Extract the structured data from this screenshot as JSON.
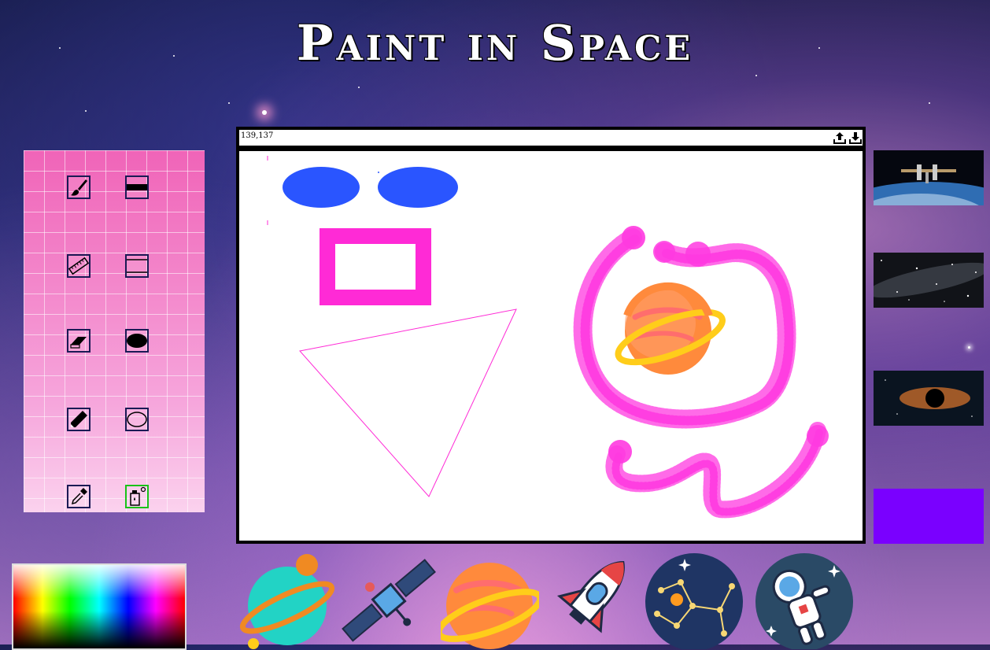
{
  "app": {
    "title": "Paint in Space"
  },
  "canvas": {
    "coordinates": "139,137",
    "upload_icon": "upload-icon",
    "download_icon": "download-icon",
    "shape_color": "#2a55ff",
    "stroke_color": "#ff2ad6"
  },
  "tools": [
    {
      "name": "brush",
      "icon": "paintbrush-icon"
    },
    {
      "name": "line",
      "icon": "line-tool-icon"
    },
    {
      "name": "ruler",
      "icon": "ruler-icon"
    },
    {
      "name": "rectangle-outline",
      "icon": "rectangle-outline-icon"
    },
    {
      "name": "eraser",
      "icon": "eraser-icon"
    },
    {
      "name": "filled-ellipse",
      "icon": "filled-ellipse-icon"
    },
    {
      "name": "pencil",
      "icon": "pencil-icon"
    },
    {
      "name": "ellipse-outline",
      "icon": "ellipse-outline-icon"
    },
    {
      "name": "eyedropper",
      "icon": "eyedropper-icon"
    },
    {
      "name": "spray-can",
      "icon": "spray-can-icon",
      "active": true
    }
  ],
  "backgrounds": [
    {
      "name": "space-station",
      "icon": "space-station-thumbnail"
    },
    {
      "name": "starfield",
      "icon": "starfield-thumbnail"
    },
    {
      "name": "black-hole",
      "icon": "black-hole-thumbnail"
    },
    {
      "name": "solid-purple",
      "color": "#7a00ff"
    }
  ],
  "stickers": [
    {
      "name": "teal-planet",
      "icon": "planet-icon"
    },
    {
      "name": "satellite",
      "icon": "satellite-icon"
    },
    {
      "name": "ringed-planet",
      "icon": "saturn-icon"
    },
    {
      "name": "rocket",
      "icon": "rocket-icon"
    },
    {
      "name": "constellation",
      "icon": "constellation-icon"
    },
    {
      "name": "astronaut",
      "icon": "astronaut-icon"
    }
  ],
  "colors": {
    "active_tool_border": "#19c219",
    "selected_background": "#7a00ff"
  }
}
